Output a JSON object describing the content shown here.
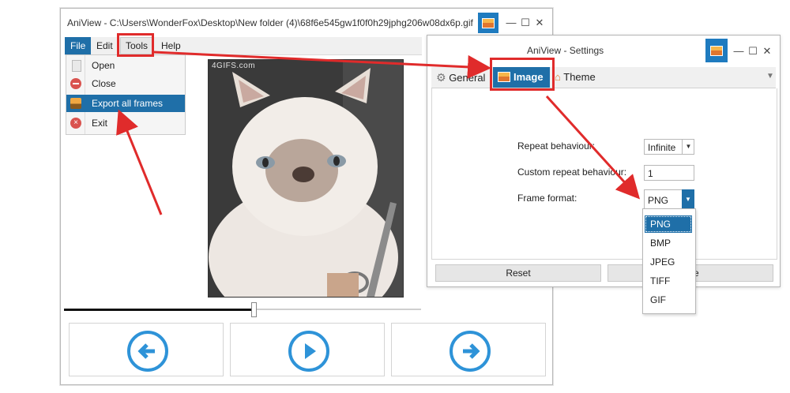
{
  "main_window": {
    "title": "AniView - C:\\Users\\WonderFox\\Desktop\\New folder (4)\\68f6e545gw1f0f0h29jphg206w08dx6p.gif",
    "menu": [
      "File",
      "Edit",
      "Tools",
      "Help"
    ],
    "file_menu": [
      "Open",
      "Close",
      "Export all frames",
      "Exit"
    ],
    "watermark": "4GIFS.com",
    "nav_buttons": [
      "previous-frame",
      "play",
      "next-frame"
    ],
    "playback_progress": 0.53
  },
  "settings_window": {
    "title": "AniView - Settings",
    "tabs": [
      "General",
      "Image",
      "Theme"
    ],
    "fields": {
      "repeat_label": "Repeat behaviour:",
      "repeat_value": "Infinite",
      "custom_repeat_label": "Custom repeat behaviour:",
      "custom_repeat_value": "1",
      "frame_format_label": "Frame format:",
      "frame_format_value": "PNG"
    },
    "format_options": [
      "PNG",
      "BMP",
      "JPEG",
      "TIFF",
      "GIF"
    ],
    "reset_label": "Reset",
    "save_label_fragment": "e"
  },
  "colors": {
    "accent_blue": "#1f6fa8",
    "icon_blue": "#2e93d8",
    "annotation_red": "#e02b2b"
  }
}
